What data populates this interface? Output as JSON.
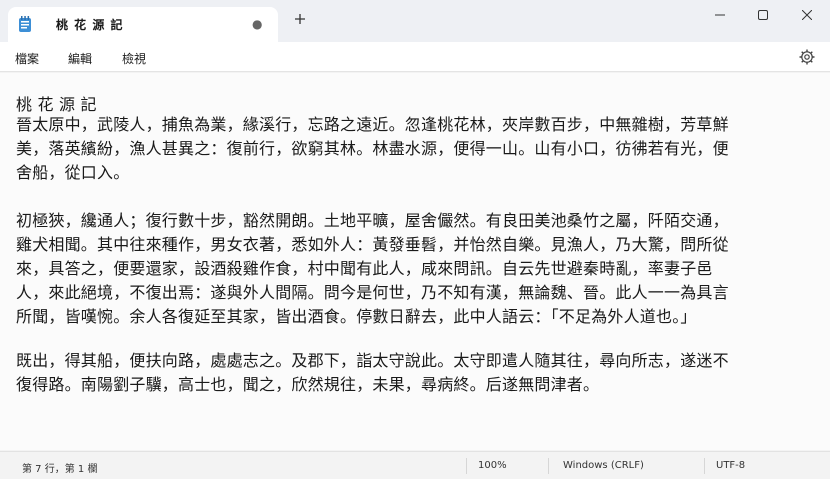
{
  "window": {
    "tab_title": "桃 花 源 記",
    "unsaved_marker": "●",
    "new_tab_icon": "plus-icon",
    "controls": [
      "minimize-icon",
      "maximize-icon",
      "close-icon"
    ]
  },
  "menu": {
    "items": [
      "檔案",
      "編輯",
      "檢視"
    ],
    "settings_icon": "gear-icon"
  },
  "document": {
    "lines": [
      "桃 花 源 記",
      "晉太原中，武陵人，捕魚為業，緣溪行，忘路之遠近。忽逢桃花林，夾岸數百步，中無雜樹，芳草鮮",
      "美，落英繽紛，漁人甚異之：復前行，欲窮其林。林盡水源，便得一山。山有小口，彷彿若有光，便",
      "舍船，從口入。",
      "",
      "初極狹，纔通人；復行數十步，豁然開朗。土地平曠，屋舍儼然。有良田美池桑竹之屬，阡陌交通，",
      "雞犬相聞。其中往來種作，男女衣著，悉如外人：黃發垂髫，并怡然自樂。見漁人，乃大驚，問所從",
      "來，具答之，便要還家，設酒殺雞作食，村中聞有此人，咸來問訊。自云先世避秦時亂，率妻子邑",
      "人，來此絕境，不復出焉：遂與外人間隔。問今是何世，乃不知有漢，無論魏、晉。此人一一為具言",
      "所聞，皆嘆惋。余人各復延至其家，皆出酒食。停數日辭去，此中人語云：「不足為外人道也。」",
      "",
      "既出，得其船，便扶向路，處處志之。及郡下，詣太守說此。太守即遣人隨其往，尋向所志，遂迷不",
      "復得路。南陽劉子驥，高士也，聞之，欣然規往，未果，尋病終。后遂無問津者。"
    ]
  },
  "status": {
    "position": "第 7 行，第 1 欄",
    "zoom": "100%",
    "line_ending": "Windows (CRLF)",
    "encoding": "UTF-8"
  }
}
